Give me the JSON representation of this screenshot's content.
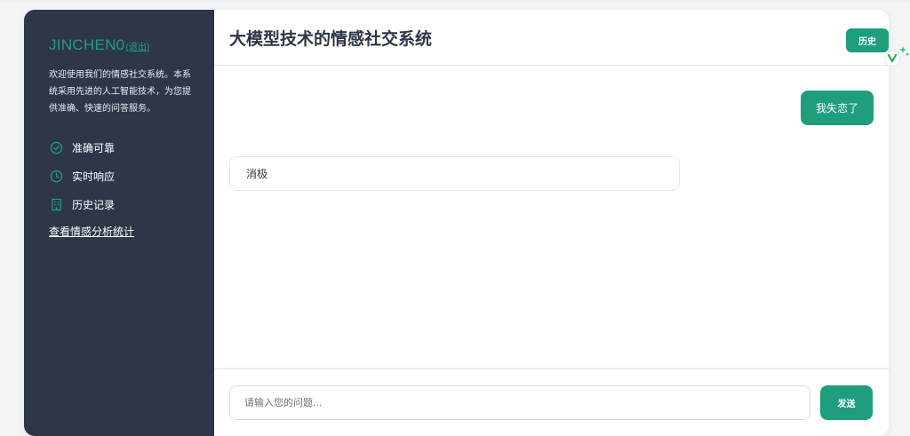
{
  "sidebar": {
    "brand": "JINCHEN0",
    "logout": "(退出)",
    "welcome": "欢迎使用我们的情感社交系统。本系统采用先进的人工智能技术，为您提供准确、快速的问答服务。",
    "features": [
      {
        "icon": "check-circle-icon",
        "label": "准确可靠"
      },
      {
        "icon": "clock-icon",
        "label": "实时响应"
      },
      {
        "icon": "building-icon",
        "label": "历史记录"
      }
    ],
    "stats_link": "查看情感分析统计"
  },
  "header": {
    "title": "大模型技术的情感社交系统",
    "history_button": "历史"
  },
  "chat": {
    "user_message": "我失恋了",
    "bot_message": "消极"
  },
  "input": {
    "placeholder": "请输入您的问题...",
    "value": "",
    "send_button": "发送"
  },
  "colors": {
    "accent": "#1f9e7e",
    "sidebar_bg": "#2d3748",
    "page_bg": "#f3f4f6"
  }
}
